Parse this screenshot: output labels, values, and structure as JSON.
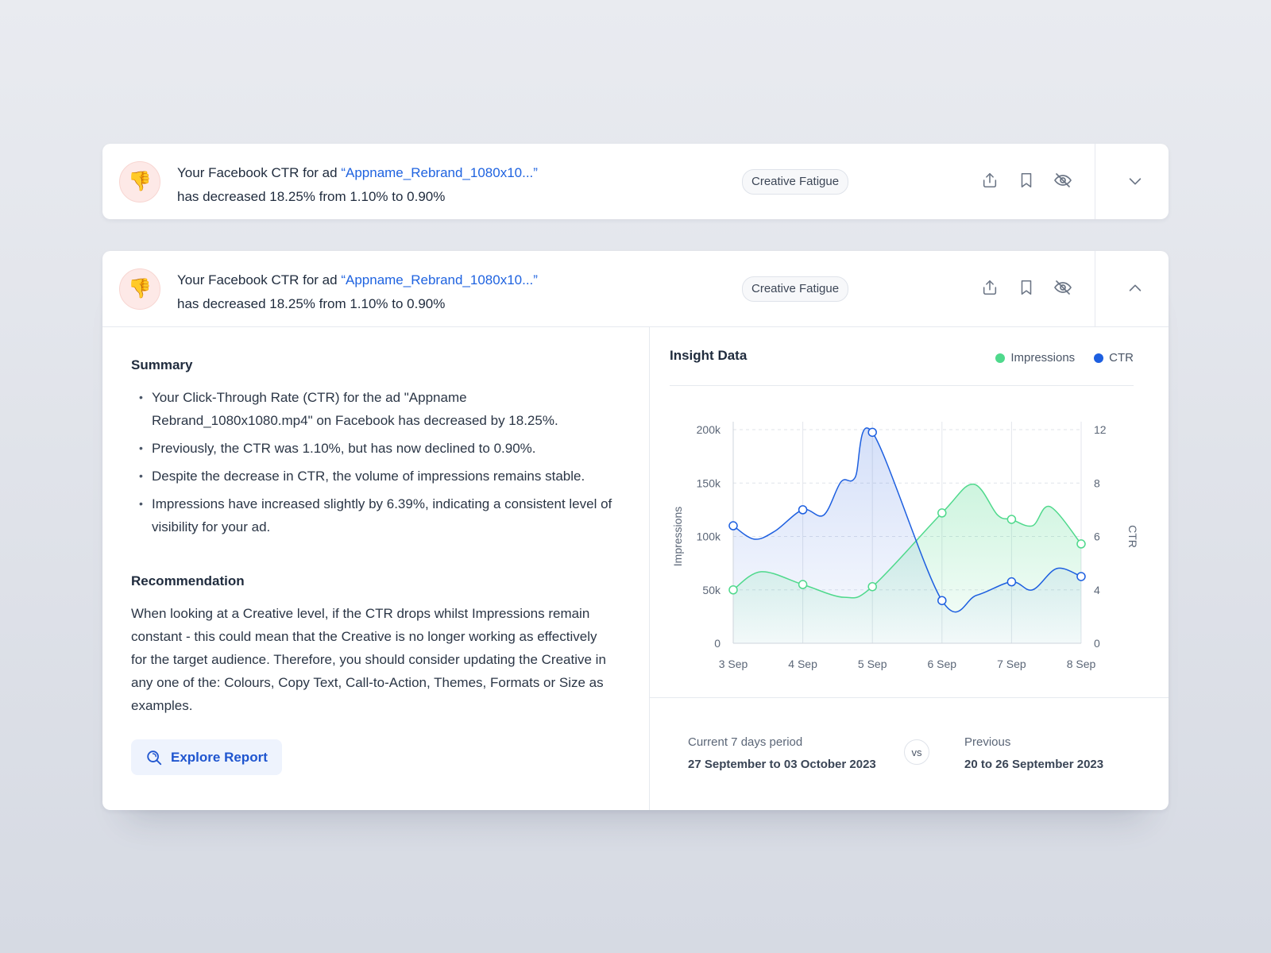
{
  "alert": {
    "prefix": "Your Facebook CTR for ad",
    "ad_name": "“Appname_Rebrand_1080x10...”",
    "detail": "has decreased 18.25% from 1.10% to 0.90%",
    "tag": "Creative Fatigue",
    "emoji": "👎",
    "icons": [
      "share-icon",
      "bookmark-icon",
      "hide-icon",
      "chevron-down-icon",
      "chevron-up-icon"
    ]
  },
  "summary": {
    "title": "Summary",
    "bullets": [
      "Your Click-Through Rate (CTR) for the ad \"Appname Rebrand_1080x1080.mp4\" on Facebook has decreased by 18.25%.",
      "Previously, the CTR was 1.10%, but has now declined to 0.90%.",
      "Despite the decrease in CTR, the volume of impressions remains stable.",
      "Impressions have increased slightly by 6.39%, indicating a consistent level of visibility for your ad."
    ]
  },
  "recommendation": {
    "title": "Recommendation",
    "text": "When looking at a Creative level, if the CTR drops whilst Impressions remain constant - this could mean that the Creative is no longer working as effectively for the target audience. Therefore, you should consider updating the Creative in any one of the: Colours, Copy Text, Call-to-Action, Themes, Formats or Size as examples."
  },
  "explore_button": "Explore Report",
  "insight": {
    "title": "Insight Data",
    "legend": {
      "impressions": "Impressions",
      "ctr": "CTR"
    }
  },
  "colors": {
    "impressions": "#4fd98c",
    "ctr": "#1d5fe0",
    "accent": "#1f63e0"
  },
  "chart_data": {
    "type": "line",
    "categories": [
      "3 Sep",
      "4 Sep",
      "5 Sep",
      "6 Sep",
      "7 Sep",
      "8 Sep"
    ],
    "x_ticks": [
      "3 Sep",
      "4 Sep",
      "5 Sep",
      "6 Sep",
      "7 Sep",
      "8 Sep"
    ],
    "y_left": {
      "label": "Impressions",
      "ticks": [
        "0",
        "50k",
        "100k",
        "150k",
        "200k"
      ],
      "range": [
        0,
        200000
      ]
    },
    "y_right": {
      "label": "CTR",
      "ticks": [
        "0",
        "4",
        "6",
        "8",
        "12"
      ]
    },
    "grid": true,
    "legend_position": "top-right",
    "series": [
      {
        "name": "Impressions",
        "axis": "left",
        "points": [
          [
            0,
            50000
          ],
          [
            0.4,
            67000
          ],
          [
            1,
            55000
          ],
          [
            1.6,
            43000
          ],
          [
            2,
            53000
          ],
          [
            3,
            122000
          ],
          [
            3.45,
            149000
          ],
          [
            3.8,
            120000
          ],
          [
            4,
            116000
          ],
          [
            4.3,
            110000
          ],
          [
            4.55,
            128000
          ],
          [
            5,
            93000
          ]
        ],
        "markers": [
          [
            0,
            50000
          ],
          [
            1,
            55000
          ],
          [
            2,
            53000
          ],
          [
            3,
            122000
          ],
          [
            4,
            116000
          ],
          [
            5,
            93000
          ]
        ]
      },
      {
        "name": "CTR",
        "axis": "right",
        "points": [
          [
            0,
            6.4
          ],
          [
            0.3,
            5.9
          ],
          [
            0.6,
            6.2
          ],
          [
            1,
            7.0
          ],
          [
            1.3,
            6.8
          ],
          [
            1.55,
            8.1
          ],
          [
            1.75,
            8.4
          ],
          [
            2,
            11.8
          ],
          [
            3,
            3.2
          ],
          [
            3.5,
            3.6
          ],
          [
            4,
            4.3
          ],
          [
            4.3,
            4.0
          ],
          [
            4.65,
            4.8
          ],
          [
            5,
            4.5
          ]
        ],
        "markers": [
          [
            0,
            6.4
          ],
          [
            1,
            7.0
          ],
          [
            2,
            11.8
          ],
          [
            3,
            3.2
          ],
          [
            4,
            4.3
          ],
          [
            5,
            4.5
          ]
        ]
      }
    ]
  },
  "periods": {
    "current_label": "Current 7 days period",
    "current_dates": "27 September to 03 October 2023",
    "vs": "vs",
    "previous_label": "Previous",
    "previous_dates": "20 to 26 September 2023"
  }
}
